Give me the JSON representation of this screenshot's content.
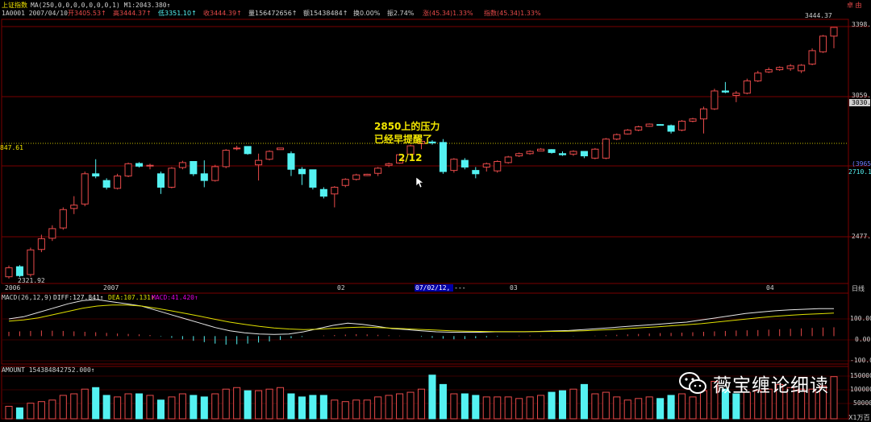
{
  "header": {
    "title": "上证指数",
    "ma_label": "MA(250,0,0,0,0,0,0,0,1) M1:2043.380↑",
    "code_date": "1A0001 2007/04/10",
    "open": "开3405.53↑",
    "high": "高3444.37↑",
    "low": "低3351.10↑",
    "close": "收3444.39↑",
    "volume": "量156472656↑",
    "amount": "额15438484↑",
    "turnover": "换0.00%",
    "amplitude": "振2.74%",
    "change": "涨(45.34)1.33%",
    "index_change": "指数(45.34)1.33%",
    "top_right": "卓 由"
  },
  "axes": {
    "price_ticks": [
      "3398.9",
      "3059.1",
      "2710.14",
      "2477.8"
    ],
    "price_flag": "3030.0",
    "price_mark": "(3965)",
    "left_level": "847.61",
    "high_label": "3444.37",
    "low_label": "2321.92",
    "date_labels": [
      "2006",
      "2007",
      "02",
      "07/02/12, ---",
      "03",
      "04"
    ],
    "period": "日线",
    "macd_ticks": [
      "100.00",
      "0.00",
      "-100.0"
    ],
    "vol_ticks": [
      "150000",
      "100000",
      "50000",
      "X1万百"
    ]
  },
  "annotations": {
    "line1": "2850上的压力",
    "line2": "已经早提醒了",
    "date": "2/12"
  },
  "macd": {
    "name": "MACD(26,12,9)",
    "diff": "DIFF:127.841↑",
    "dea": "DEA:107.131↑",
    "macd": "MACD:41.420↑"
  },
  "volume_panel": {
    "label": "AMOUNT 154384842752.000↑"
  },
  "watermark": {
    "text": "薇宝缠论细读"
  },
  "colors": {
    "up": "#e84a4a",
    "down": "#54f2f2",
    "grid": "#7a0000",
    "dotted": "#c8c000",
    "diff_line": "#e8e8e8",
    "dea_line": "#e0e000",
    "annotation": "#f2e600"
  },
  "chart_data": {
    "type": "candlestick",
    "ohlc": [
      [
        2330,
        2380,
        2322,
        2370
      ],
      [
        2375,
        2382,
        2328,
        2335
      ],
      [
        2340,
        2460,
        2330,
        2450
      ],
      [
        2452,
        2518,
        2440,
        2500
      ],
      [
        2502,
        2560,
        2490,
        2545
      ],
      [
        2548,
        2640,
        2540,
        2630
      ],
      [
        2635,
        2690,
        2610,
        2650
      ],
      [
        2655,
        2800,
        2645,
        2790
      ],
      [
        2790,
        2855,
        2770,
        2780
      ],
      [
        2760,
        2770,
        2720,
        2730
      ],
      [
        2725,
        2790,
        2720,
        2780
      ],
      [
        2780,
        2840,
        2775,
        2835
      ],
      [
        2836,
        2842,
        2818,
        2824
      ],
      [
        2826,
        2835,
        2810,
        2828
      ],
      [
        2790,
        2800,
        2700,
        2730
      ],
      [
        2730,
        2820,
        2725,
        2815
      ],
      [
        2818,
        2848,
        2810,
        2840
      ],
      [
        2845,
        2840,
        2780,
        2790
      ],
      [
        2790,
        2850,
        2730,
        2760
      ],
      [
        2760,
        2830,
        2755,
        2822
      ],
      [
        2822,
        2900,
        2815,
        2895
      ],
      [
        2902,
        2915,
        2895,
        2905
      ],
      [
        2912,
        2912,
        2875,
        2880
      ],
      [
        2830,
        2880,
        2760,
        2850
      ],
      [
        2855,
        2895,
        2850,
        2890
      ],
      [
        2898,
        2900,
        2905,
        2905
      ],
      [
        2880,
        2890,
        2780,
        2810
      ],
      [
        2810,
        2820,
        2740,
        2790
      ],
      [
        2808,
        2808,
        2720,
        2730
      ],
      [
        2720,
        2730,
        2680,
        2690
      ],
      [
        2700,
        2735,
        2640,
        2730
      ],
      [
        2738,
        2770,
        2730,
        2765
      ],
      [
        2765,
        2790,
        2760,
        2785
      ],
      [
        2782,
        2790,
        2780,
        2788
      ],
      [
        2792,
        2820,
        2780,
        2815
      ],
      [
        2828,
        2840,
        2820,
        2835
      ],
      [
        2838,
        2880,
        2835,
        2875
      ],
      [
        2878,
        2920,
        2870,
        2915
      ],
      [
        2925,
        2940,
        2900,
        2935
      ],
      [
        2932,
        2940,
        2920,
        2928
      ],
      [
        2930,
        2945,
        2790,
        2800
      ],
      [
        2805,
        2860,
        2795,
        2855
      ],
      [
        2850,
        2860,
        2810,
        2820
      ],
      [
        2805,
        2820,
        2770,
        2790
      ],
      [
        2820,
        2840,
        2800,
        2835
      ],
      [
        2803,
        2850,
        2795,
        2845
      ],
      [
        2840,
        2870,
        2835,
        2865
      ],
      [
        2870,
        2885,
        2865,
        2880
      ],
      [
        2880,
        2895,
        2875,
        2890
      ],
      [
        2892,
        2905,
        2890,
        2900
      ],
      [
        2898,
        2900,
        2880,
        2885
      ],
      [
        2880,
        2890,
        2870,
        2875
      ],
      [
        2878,
        2895,
        2870,
        2890
      ],
      [
        2890,
        2890,
        2860,
        2870
      ],
      [
        2860,
        2905,
        2855,
        2900
      ],
      [
        2860,
        2950,
        2855,
        2945
      ],
      [
        2945,
        2970,
        2940,
        2965
      ],
      [
        2968,
        2990,
        2965,
        2985
      ],
      [
        2985,
        3005,
        2980,
        3000
      ],
      [
        3002,
        3015,
        3000,
        3012
      ],
      [
        3010,
        3012,
        3005,
        3007
      ],
      [
        3005,
        3010,
        2970,
        2980
      ],
      [
        2985,
        3030,
        2980,
        3025
      ],
      [
        3025,
        3040,
        3020,
        3035
      ],
      [
        3035,
        3090,
        2970,
        3080
      ],
      [
        3080,
        3170,
        3075,
        3160
      ],
      [
        3160,
        3200,
        3150,
        3155
      ],
      [
        3140,
        3160,
        3110,
        3150
      ],
      [
        3150,
        3215,
        3145,
        3205
      ],
      [
        3205,
        3250,
        3200,
        3240
      ],
      [
        3245,
        3265,
        3240,
        3255
      ],
      [
        3255,
        3270,
        3250,
        3265
      ],
      [
        3260,
        3280,
        3250,
        3272
      ],
      [
        3250,
        3280,
        3240,
        3275
      ],
      [
        3280,
        3350,
        3275,
        3340
      ],
      [
        3335,
        3410,
        3330,
        3405
      ],
      [
        3405,
        3444,
        3351,
        3444
      ]
    ],
    "volume": [
      40,
      35,
      50,
      55,
      60,
      75,
      80,
      95,
      100,
      75,
      70,
      80,
      80,
      75,
      60,
      70,
      80,
      75,
      70,
      80,
      95,
      100,
      90,
      90,
      95,
      100,
      80,
      70,
      75,
      75,
      60,
      55,
      60,
      60,
      70,
      75,
      80,
      85,
      95,
      140,
      110,
      80,
      80,
      75,
      70,
      70,
      70,
      65,
      70,
      75,
      85,
      90,
      95,
      110,
      80,
      85,
      70,
      60,
      65,
      70,
      65,
      75,
      80,
      70,
      90,
      120,
      95,
      80,
      85,
      90,
      95,
      110,
      100,
      95,
      95,
      105,
      135
    ],
    "up_volume": [
      1,
      0,
      1,
      1,
      1,
      1,
      1,
      1,
      0,
      0,
      1,
      1,
      0,
      1,
      0,
      1,
      1,
      0,
      0,
      1,
      1,
      1,
      0,
      1,
      1,
      1,
      0,
      0,
      0,
      0,
      1,
      1,
      1,
      1,
      1,
      1,
      1,
      1,
      1,
      0,
      0,
      1,
      0,
      0,
      1,
      1,
      1,
      1,
      1,
      1,
      0,
      0,
      1,
      0,
      1,
      1,
      1,
      1,
      1,
      1,
      0,
      0,
      1,
      1,
      1,
      1,
      0,
      0,
      1,
      1,
      1,
      1,
      1,
      1,
      1,
      1,
      1
    ],
    "macd_hist": [
      20,
      22,
      24,
      26,
      25,
      24,
      22,
      20,
      18,
      15,
      12,
      10,
      8,
      5,
      -2,
      -8,
      -15,
      -22,
      -28,
      -35,
      -40,
      -38,
      -35,
      -30,
      -25,
      -18,
      -10,
      -4,
      0,
      3,
      5,
      7,
      9,
      8,
      6,
      4,
      2,
      0,
      -3,
      -8,
      -12,
      -15,
      -14,
      -10,
      -6,
      -3,
      0,
      2,
      3,
      2,
      1,
      0,
      -1,
      0,
      2,
      4,
      6,
      8,
      10,
      12,
      14,
      15,
      16,
      18,
      20,
      22,
      24,
      26,
      27,
      28,
      30,
      32,
      34,
      36,
      38,
      40,
      41
    ],
    "diff_line": [
      80,
      90,
      110,
      130,
      150,
      165,
      170,
      160,
      150,
      140,
      120,
      100,
      80,
      60,
      40,
      25,
      15,
      10,
      8,
      10,
      20,
      35,
      50,
      60,
      55,
      45,
      35,
      30,
      25,
      20,
      18,
      18,
      18,
      20,
      20,
      20,
      22,
      24,
      26,
      30,
      35,
      40,
      45,
      50,
      55,
      60,
      65,
      75,
      85,
      95,
      105,
      112,
      118,
      122,
      125,
      128,
      128
    ],
    "dea_line": [
      70,
      75,
      85,
      100,
      115,
      130,
      140,
      145,
      145,
      140,
      130,
      118,
      105,
      92,
      78,
      65,
      55,
      45,
      38,
      33,
      30,
      32,
      36,
      40,
      42,
      40,
      37,
      34,
      31,
      28,
      25,
      23,
      22,
      21,
      21,
      21,
      21,
      22,
      23,
      25,
      28,
      31,
      35,
      39,
      43,
      48,
      53,
      58,
      65,
      72,
      79,
      86,
      92,
      97,
      101,
      104,
      107
    ],
    "ylim": [
      2300,
      3480
    ],
    "macd_ylim": [
      -130,
      200
    ],
    "vol_ylim": [
      0,
      160
    ]
  }
}
